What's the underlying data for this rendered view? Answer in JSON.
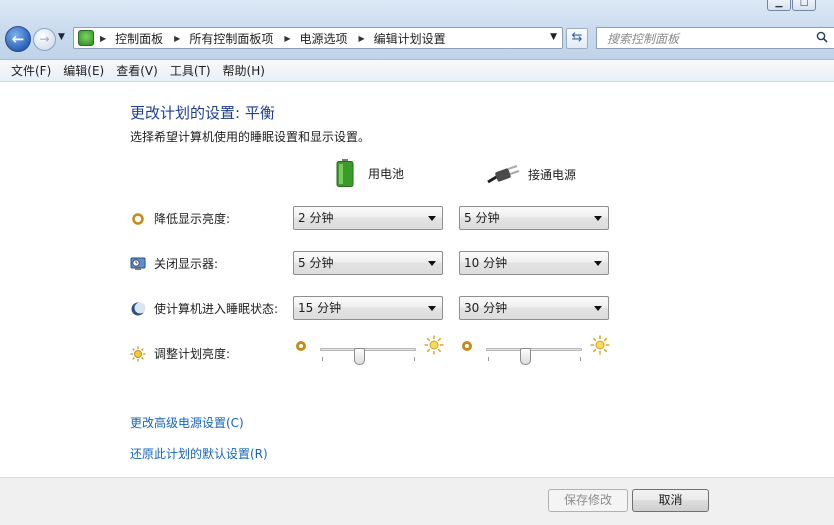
{
  "addressBar": {
    "crumbs": [
      "控制面板",
      "所有控制面板项",
      "电源选项",
      "编辑计划设置"
    ]
  },
  "search": {
    "placeholder": "搜索控制面板"
  },
  "menu": [
    "文件(F)",
    "编辑(E)",
    "查看(V)",
    "工具(T)",
    "帮助(H)"
  ],
  "page": {
    "title": "更改计划的设置: 平衡",
    "subtitle": "选择希望计算机使用的睡眠设置和显示设置。"
  },
  "columns": {
    "battery": "用电池",
    "plugged": "接通电源"
  },
  "rows": [
    {
      "label": "降低显示亮度:",
      "battery": "2 分钟",
      "plugged": "5 分钟",
      "icon": "dim-brightness-icon"
    },
    {
      "label": "关闭显示器:",
      "battery": "5 分钟",
      "plugged": "10 分钟",
      "icon": "monitor-off-icon"
    },
    {
      "label": "使计算机进入睡眠状态:",
      "battery": "15 分钟",
      "plugged": "30 分钟",
      "icon": "sleep-moon-icon"
    }
  ],
  "brightness": {
    "label": "调整计划亮度:",
    "battery_level": 0.4,
    "plugged_level": 0.4
  },
  "links": {
    "advanced": "更改高级电源设置(C)",
    "restore": "还原此计划的默认设置(R)"
  },
  "buttons": {
    "save": "保存修改",
    "cancel": "取消"
  },
  "colors": {
    "title": "#1e3f8f",
    "link": "#1565b8",
    "accent": "#2a62b8"
  }
}
